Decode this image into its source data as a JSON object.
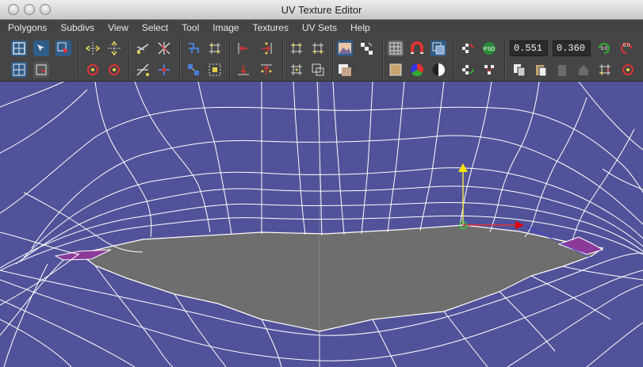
{
  "window": {
    "title": "UV Texture Editor"
  },
  "menu": [
    "Polygons",
    "Subdivs",
    "View",
    "Select",
    "Tool",
    "Image",
    "Textures",
    "UV Sets",
    "Help"
  ],
  "toolbar": {
    "u_value": "0.551",
    "v_value": "0.360",
    "rotate_amount": "0.0"
  },
  "colors": {
    "uv_background": "#52529a",
    "selected_face": "#6e6e6e",
    "wireframe": "#ffffff",
    "menubar": "#444444",
    "toolbar": "#454545"
  },
  "icons": [
    "select-uv-icon",
    "move-uv-icon",
    "move-uv-red-icon",
    "flip-icon",
    "rotate-ccw-icon",
    "rotate-cw-icon",
    "cut-uv-icon",
    "sew-uv-icon",
    "unfold-icon",
    "layout-icon",
    "align-icon",
    "snap-icon",
    "image-toggle-icon",
    "checker-icon",
    "grid-icon",
    "magnet-icon",
    "shaded-uv-icon",
    "texture-borders-icon",
    "rgb-channels-icon",
    "display-icon",
    "image-range-icon",
    "checker-psd-icon",
    "copy-icon",
    "paste-icon",
    "lock-icon"
  ]
}
